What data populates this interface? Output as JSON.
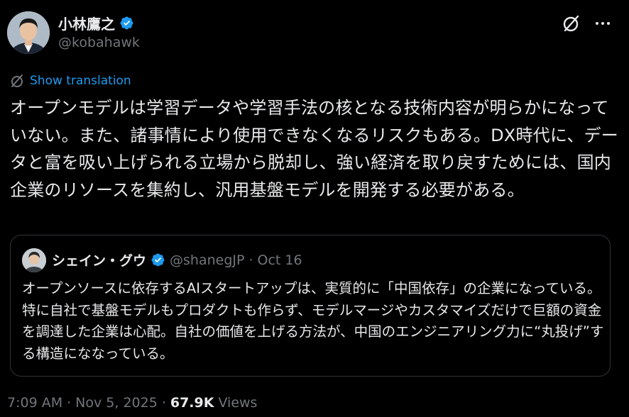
{
  "author": {
    "name": "小林鷹之",
    "handle": "@kobahawk"
  },
  "translate_label": "Show translation",
  "tweet_text": "オープンモデルは学習データや学習手法の核となる技術内容が明らかになっていない。また、諸事情により使用できなくなるリスクもある。DX時代に、データと富を吸い上げられる立場から脱却し、強い経済を取り戻すためには、国内企業のリソースを集約し、汎用基盤モデルを開発する必要がある。",
  "quote": {
    "name": "シェイン・グウ",
    "handle": "@shanegJP",
    "separator": "·",
    "date": "Oct 16",
    "text": "オープンソースに依存するAIスタートアップは、実質的に「中国依存」の企業になっている。特に自社で基盤モデルもプロダクトも作らず、モデルマージやカスタマイズだけで巨額の資金を調達した企業は心配。自社の価値を上げる方法が、中国のエンジニアリング力に“丸投げ”する構造にななっている。"
  },
  "footer": {
    "time": "7:09 AM",
    "sep1": "·",
    "date": "Nov 5, 2025",
    "sep2": "·",
    "views_count": "67.9K",
    "views_label": "Views"
  },
  "colors": {
    "background": "#000000",
    "text": "#e7e9ea",
    "secondary": "#71767b",
    "accent": "#1d9bf0",
    "border": "#2f3336"
  },
  "icons": [
    "verified-badge-icon",
    "grok-icon",
    "more-icon",
    "translate-icon"
  ]
}
